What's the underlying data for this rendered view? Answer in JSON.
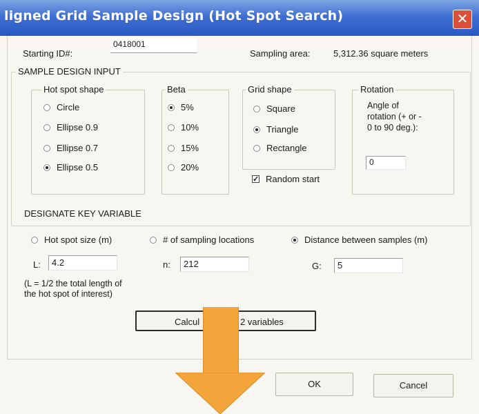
{
  "window": {
    "title": "ligned Grid Sample Design (Hot Spot Search)",
    "close_glyph": "✕"
  },
  "header": {
    "starting_id_label": "Starting ID#:",
    "starting_id_value": "0418001",
    "sampling_area_label": "Sampling area:",
    "sampling_area_value": "5,312.36 square meters"
  },
  "sample_design": {
    "title": "SAMPLE DESIGN INPUT",
    "hot_spot_shape": {
      "legend": "Hot spot shape",
      "options": [
        "Circle",
        "Ellipse 0.9",
        "Ellipse 0.7",
        "Ellipse 0.5"
      ],
      "selected": "Ellipse 0.5"
    },
    "beta": {
      "legend": "Beta",
      "options": [
        "5%",
        "10%",
        "15%",
        "20%"
      ],
      "selected": "5%"
    },
    "grid_shape": {
      "legend": "Grid shape",
      "options": [
        "Square",
        "Triangle",
        "Rectangle"
      ],
      "selected": "Triangle"
    },
    "random_start": {
      "label": "Random start",
      "checked": true
    },
    "rotation": {
      "legend": "Rotation",
      "description_line1": "Angle of",
      "description_line2": "rotation (+ or -",
      "description_line3": "0 to 90 deg.):",
      "value": "0"
    }
  },
  "key_variable": {
    "title": "DESIGNATE KEY VARIABLE",
    "options": [
      "Hot spot size (m)",
      "# of sampling locations",
      "Distance between samples (m)"
    ],
    "selected": "Distance between samples (m)",
    "l_label": "L:",
    "l_value": "4.2",
    "n_label": "n:",
    "n_value": "212",
    "g_label": "G:",
    "g_value": "5",
    "note_line1": "(L = 1/2 the total length of",
    "note_line2": "the hot spot of interest)",
    "calc_left": "Calcul",
    "calc_right": "r 2 variables"
  },
  "buttons": {
    "ok": "OK",
    "cancel": "Cancel"
  },
  "overlay": {
    "arrow_color": "#f3a53c",
    "direction": "down"
  }
}
